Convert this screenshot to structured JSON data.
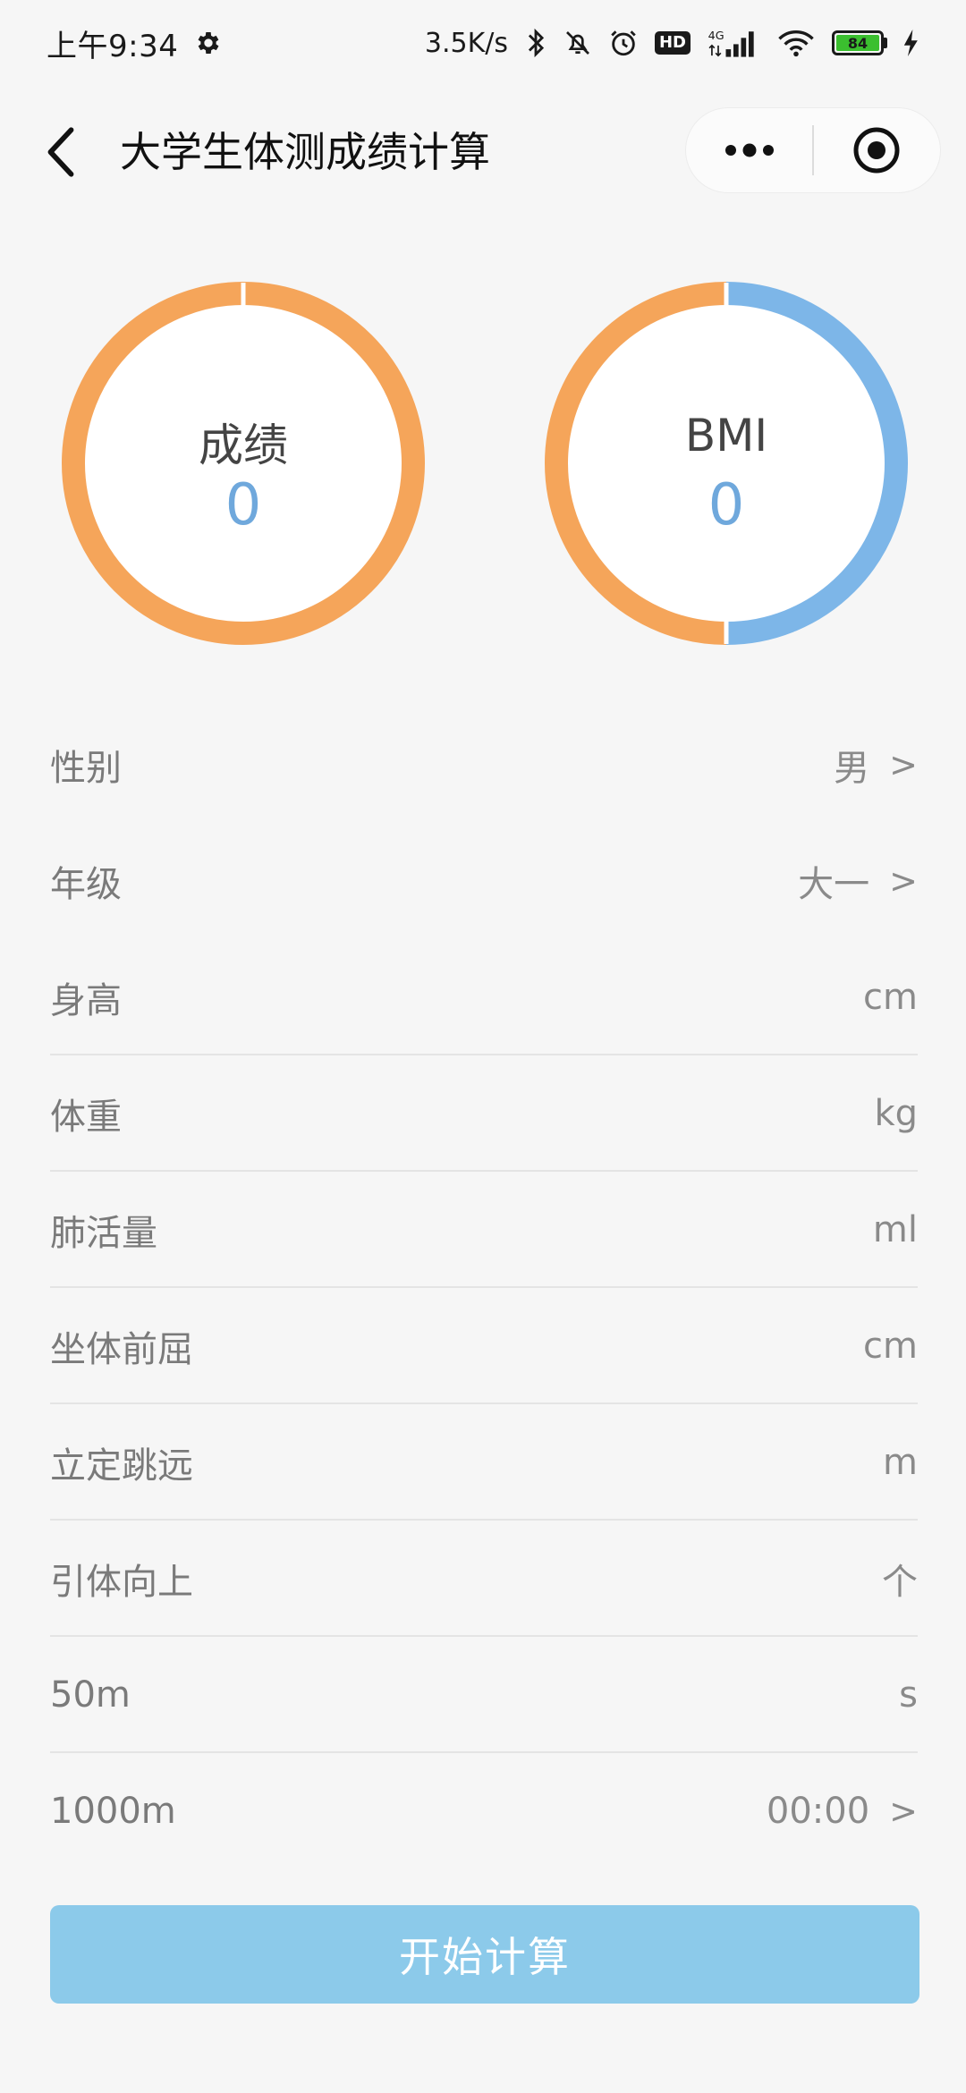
{
  "status_bar": {
    "time": "上午9:34",
    "net_speed": "3.5K/s",
    "hd": "HD",
    "signal_type": "4G",
    "battery": "84"
  },
  "nav": {
    "title": "大学生体测成绩计算"
  },
  "score_ring": {
    "label": "成绩",
    "value": "0",
    "color": "#f5a55a",
    "track_color": "#ffffff"
  },
  "bmi_ring": {
    "label": "BMI",
    "value": "0",
    "left_color": "#f5a55a",
    "right_color": "#7db6e8"
  },
  "form": {
    "gender": {
      "label": "性别",
      "value": "男",
      "chevron": ">"
    },
    "grade": {
      "label": "年级",
      "value": "大一",
      "chevron": ">"
    },
    "height": {
      "label": "身高",
      "unit": "cm"
    },
    "weight": {
      "label": "体重",
      "unit": "kg"
    },
    "lung": {
      "label": "肺活量",
      "unit": "ml"
    },
    "sit_reach": {
      "label": "坐体前屈",
      "unit": "cm"
    },
    "long_jump": {
      "label": "立定跳远",
      "unit": "m"
    },
    "pull_up": {
      "label": "引体向上",
      "unit": "个"
    },
    "run50": {
      "label": "50m",
      "unit": "s"
    },
    "run1000": {
      "label": "1000m",
      "value": "00:00",
      "chevron": ">"
    }
  },
  "button": {
    "label": "开始计算",
    "color": "#8ccaea"
  },
  "icons": {
    "settings": "gear-icon",
    "bluetooth": "bluetooth-icon",
    "mute": "bell-off-icon",
    "alarm": "alarm-icon",
    "signal": "signal-icon",
    "wifi": "wifi-icon",
    "charging": "bolt-icon",
    "back": "back-arrow-icon",
    "more": "more-icon",
    "close": "target-icon"
  }
}
